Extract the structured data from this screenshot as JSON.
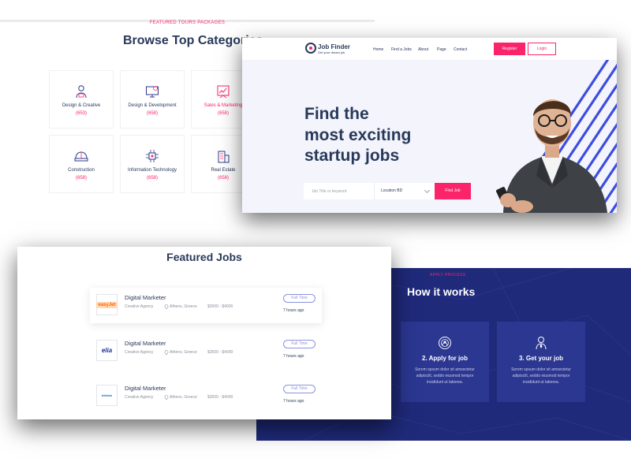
{
  "categories_panel": {
    "eyebrow": "FEATURED TOURS PACKAGES",
    "title": "Browse Top Categories",
    "items": [
      {
        "name": "Design & Creative",
        "count": "(653)",
        "icon": "designer-icon"
      },
      {
        "name": "Design & Development",
        "count": "(658)",
        "icon": "monitor-code-icon"
      },
      {
        "name": "Sales & Marketing",
        "count": "(658)",
        "icon": "marketing-board-icon",
        "highlight": true
      },
      {
        "name": "Construction",
        "count": "(658)",
        "icon": "hard-hat-icon"
      },
      {
        "name": "Information Technology",
        "count": "(658)",
        "icon": "chip-icon"
      },
      {
        "name": "Real Estate",
        "count": "(658)",
        "icon": "building-icon"
      }
    ]
  },
  "hero": {
    "logo_name": "Job Finder",
    "logo_tagline": "Get your dream job",
    "nav": [
      "Home",
      "Find a Jobs",
      "About",
      "Page",
      "Contact"
    ],
    "register_label": "Register",
    "login_label": "Login",
    "headline_lines": [
      "Find the",
      "most exciting",
      "startup jobs"
    ],
    "search_placeholder": "Job Title or keyword",
    "location_value": "Location BD",
    "find_button": "Find Job",
    "accent_color": "#fb246a",
    "stripe_color": "#3d4de0"
  },
  "jobs_panel": {
    "title": "Featured Jobs",
    "jobs": [
      {
        "title": "Digital Marketer",
        "company": "Creative Agency",
        "location": "Athens, Greece",
        "salary": "$3500 - $4000",
        "type": "Full Time",
        "posted": "7 hours ago",
        "logo": "easyJet"
      },
      {
        "title": "Digital Marketer",
        "company": "Creative Agency",
        "location": "Athens, Greece",
        "salary": "$3500 - $4000",
        "type": "Full Time",
        "posted": "7 hours ago",
        "logo": "elia"
      },
      {
        "title": "Digital Marketer",
        "company": "Creative Agency",
        "location": "Athens, Greece",
        "salary": "$3500 - $4000",
        "type": "Full Time",
        "posted": "7 hours ago",
        "logo": "telekom"
      }
    ]
  },
  "how_panel": {
    "eyebrow": "APPLY PROCESS",
    "title": "How it works",
    "steps": [
      {
        "title": "2. Apply for job",
        "desc": "Sorem spsum dolor sit amsectetur adipisclit, seddo eiusmod tempor incididunt ut laborea.",
        "icon": "target-user-icon"
      },
      {
        "title": "3. Get your job",
        "desc": "Sorem spsum dolor sit amsectetur adipisclit, seddo eiusmod tempor incididunt ut laborea.",
        "icon": "employee-icon"
      }
    ],
    "bg_color": "#1f2a7a"
  }
}
